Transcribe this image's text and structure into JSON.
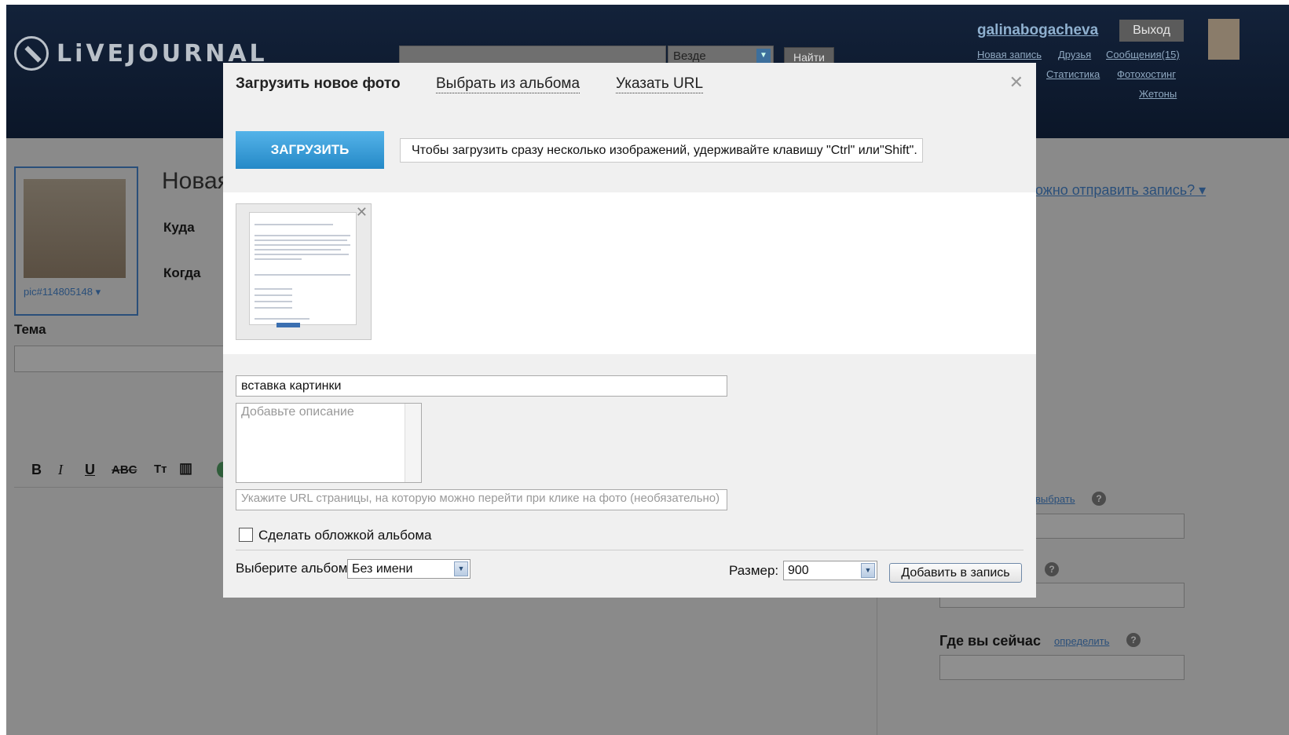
{
  "header": {
    "logo_text": "LiVEJOURNAL",
    "search_scope": "Везде",
    "find_button": "Найти",
    "username": "galinabogacheva",
    "exit_button": "Выход",
    "links": [
      "Новая запись",
      "Друзья",
      "Сообщения(15)",
      "Статистика",
      "Фотохостинг",
      "Жетоны"
    ]
  },
  "background_page": {
    "userpic_caption": "pic#114805148 ▾",
    "title_partial": "Новая",
    "where_label": "Куда",
    "when_label": "Когда",
    "subject_label": "Тема",
    "send_question": "ожно отправить запись? ▾",
    "choose_link": "выбрать",
    "location_label": "Где вы сейчас",
    "detect_link": "определить",
    "editor_buttons": [
      "B",
      "I",
      "U",
      "ABC",
      "Tт",
      "▥"
    ]
  },
  "dialog": {
    "tabs": [
      "Загрузить новое фото",
      "Выбрать из альбома",
      "Указать URL"
    ],
    "close_glyph": "✕",
    "upload_button": "ЗАГРУЗИТЬ",
    "upload_hint": "Чтобы загрузить сразу несколько изображений, удерживайте клавишу \"Ctrl\" или\"Shift\".",
    "title_value": "вставка картинки",
    "description_placeholder": "Добавьте описание",
    "url_placeholder": "Укажите URL страницы, на которую можно перейти при клике на фото (необязательно)",
    "cover_label": "Сделать обложкой альбома",
    "album_label": "Выберите альбом:",
    "album_value": "Без имени",
    "size_label": "Размер:",
    "size_value": "900",
    "add_button": "Добавить в запись"
  }
}
